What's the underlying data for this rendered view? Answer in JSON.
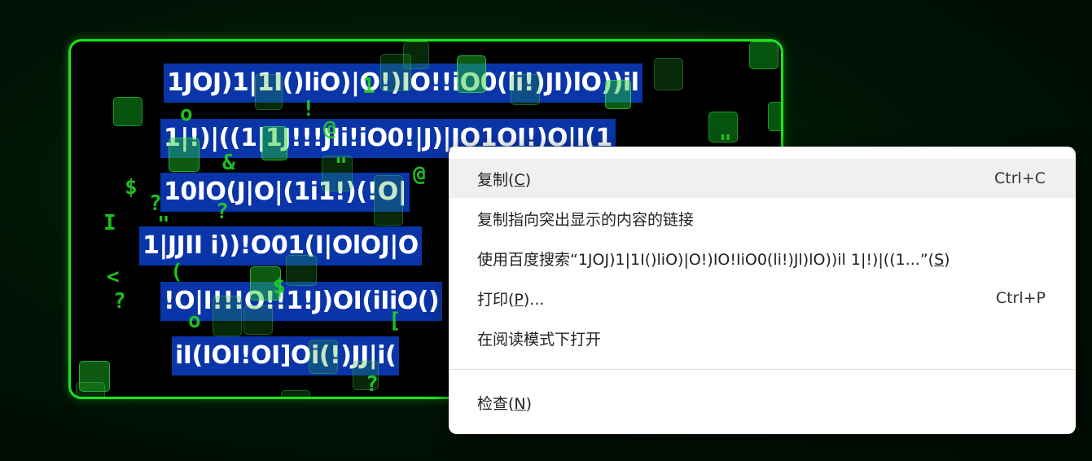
{
  "stage": {
    "border_color": "#19e619",
    "highlight_color": "#0a35a8",
    "lines": [
      "1JOJ)1|1I()liO)|O!)IO!!iO0(li!)JI)lO))il",
      "1|!)|((1|1J!!!JIi!iO0!|J)|JO1OI!)O|I(1",
      "10IO(J|O|(1i1!)(!O|",
      "1|JJII i))!O01(I|OlOJ|O",
      "!O|I!!!O!!1!J)OI(iIiO()",
      "iI(IOI!OI]Oi(!)JJ|i("
    ],
    "glyphs": [
      "o",
      "&",
      "\"",
      "$",
      "?",
      "I",
      "\"",
      "?",
      "(",
      "o",
      "<",
      "?",
      "o",
      "1",
      "@",
      "1",
      "!",
      "?",
      "&",
      "[",
      "$",
      "?",
      "@",
      "u",
      "\""
    ]
  },
  "menu": {
    "items": [
      {
        "label_before": "复制(",
        "accel": "C",
        "label_after": ")",
        "shortcut": "Ctrl+C",
        "hover": true
      },
      {
        "label_before": "复制指向突出显示的内容的链接",
        "accel": "",
        "label_after": "",
        "shortcut": ""
      },
      {
        "label_before": "使用百度搜索“1JOJ)1|1I()liO)|O!)IO!IiO0(li!)Jl)lO))il 1|!)|((1...”(",
        "accel": "S",
        "label_after": ")",
        "shortcut": ""
      },
      {
        "label_before": "打印(",
        "accel": "P",
        "label_after": ")...",
        "shortcut": "Ctrl+P"
      },
      {
        "label_before": "在阅读模式下打开",
        "accel": "",
        "label_after": "",
        "shortcut": ""
      },
      {
        "label_before": "检查(",
        "accel": "N",
        "label_after": ")",
        "shortcut": ""
      }
    ]
  }
}
